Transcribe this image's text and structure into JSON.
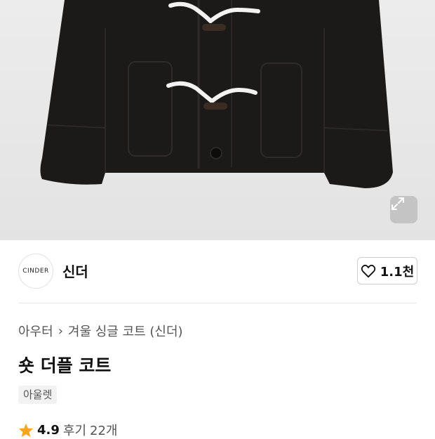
{
  "hero": {
    "image_alt_subject": "black duffle coat with white toggle closures",
    "expand_icon": "expand-arrows-icon"
  },
  "brand": {
    "logo_text": "CINDER",
    "name": "신더",
    "like_icon": "heart-outline-icon",
    "like_count": "1.1천"
  },
  "breadcrumb": {
    "category": "아우터",
    "separator_icon": "chevron-right-icon",
    "separator": "›",
    "subcategory": "겨울 싱글 코트 (신더)"
  },
  "product": {
    "title": "숏 더플 코트",
    "tag": "아울렛",
    "rating_icon": "star-icon",
    "rating": "4.9",
    "review_label": "후기",
    "review_count": "22개"
  },
  "colors": {
    "star": "#f5a623",
    "coat": "#1c1a18",
    "hero_bg": "#e8e8e8"
  }
}
